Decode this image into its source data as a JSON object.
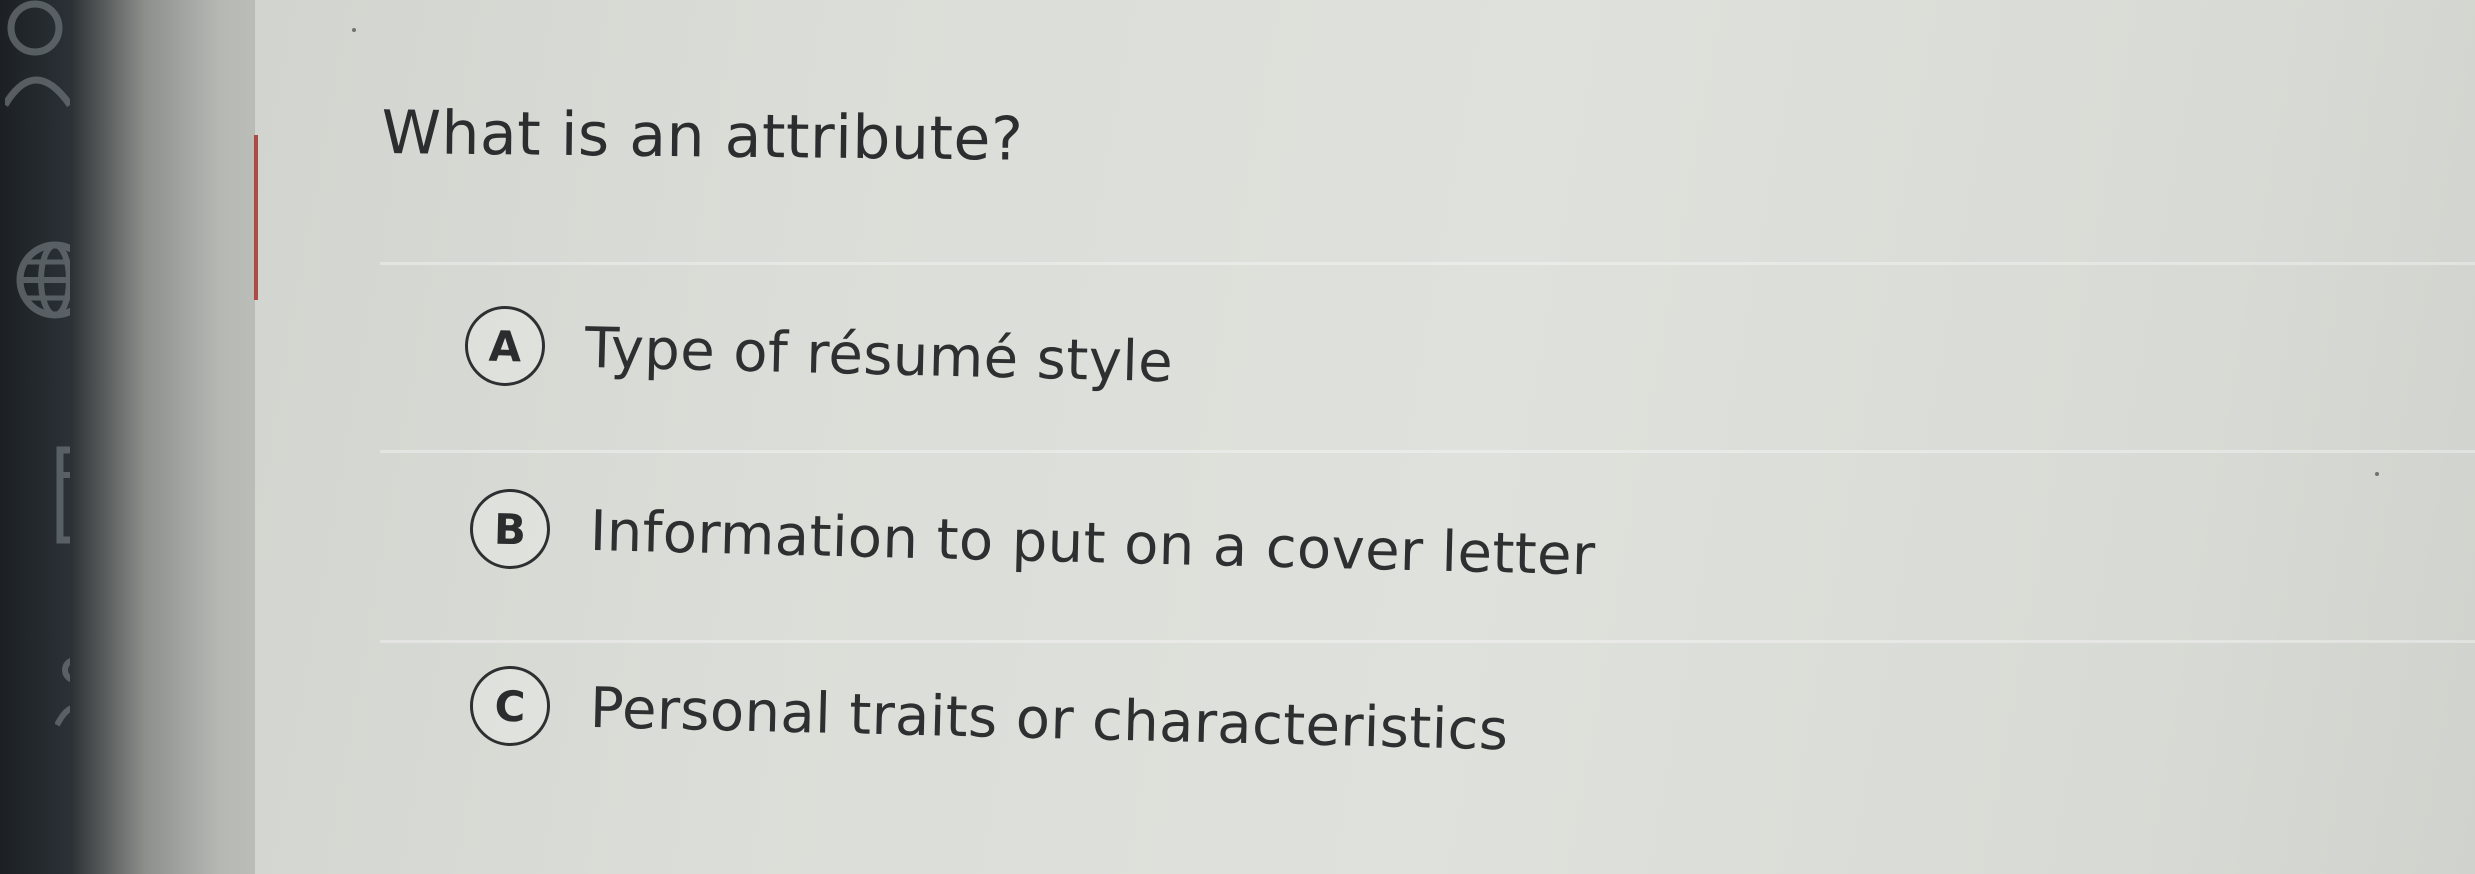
{
  "question": {
    "text": "What is an attribute?"
  },
  "options": [
    {
      "letter": "A",
      "text": "Type of résumé style"
    },
    {
      "letter": "B",
      "text": "Information to put on a cover letter"
    },
    {
      "letter": "C",
      "text": "Personal traits or characteristics"
    }
  ],
  "sidebar": {
    "icons": [
      "user-icon",
      "globe-icon",
      "building-icon",
      "people-icon"
    ]
  },
  "colors": {
    "text": "#2e2f30",
    "background": "#dcded9",
    "accent_marker": "#a8322e"
  }
}
